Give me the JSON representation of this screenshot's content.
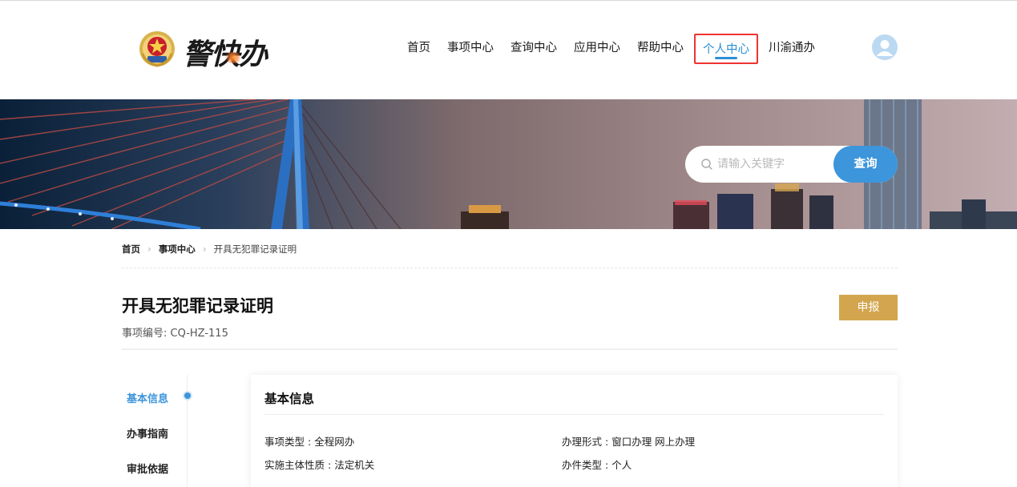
{
  "header": {
    "logo_text": "警快办",
    "nav": [
      {
        "label": "首页",
        "active": false
      },
      {
        "label": "事项中心",
        "active": false
      },
      {
        "label": "查询中心",
        "active": false
      },
      {
        "label": "应用中心",
        "active": false
      },
      {
        "label": "帮助中心",
        "active": false
      },
      {
        "label": "个人中心",
        "active": true
      },
      {
        "label": "川渝通办",
        "active": false
      }
    ]
  },
  "search": {
    "placeholder": "请输入关键字",
    "button_label": "查询"
  },
  "breadcrumb": [
    "首页",
    "事项中心",
    "开具无犯罪记录证明"
  ],
  "item": {
    "title": "开具无犯罪记录证明",
    "code_label": "事项编号:",
    "code_value": "CQ-HZ-115",
    "apply_label": "申报"
  },
  "side_nav": [
    {
      "label": "基本信息",
      "active": true
    },
    {
      "label": "办事指南",
      "active": false
    },
    {
      "label": "审批依据",
      "active": false
    }
  ],
  "info_card": {
    "title": "基本信息",
    "fields": [
      {
        "label": "事项类型",
        "value": "全程网办"
      },
      {
        "label": "办理形式",
        "value": "窗口办理 网上办理"
      },
      {
        "label": "实施主体性质",
        "value": "法定机关"
      },
      {
        "label": "办件类型",
        "value": "个人"
      }
    ]
  },
  "colors": {
    "accent_blue": "#3d95db",
    "apply_gold": "#d3a54e",
    "active_border": "#ee3333"
  }
}
